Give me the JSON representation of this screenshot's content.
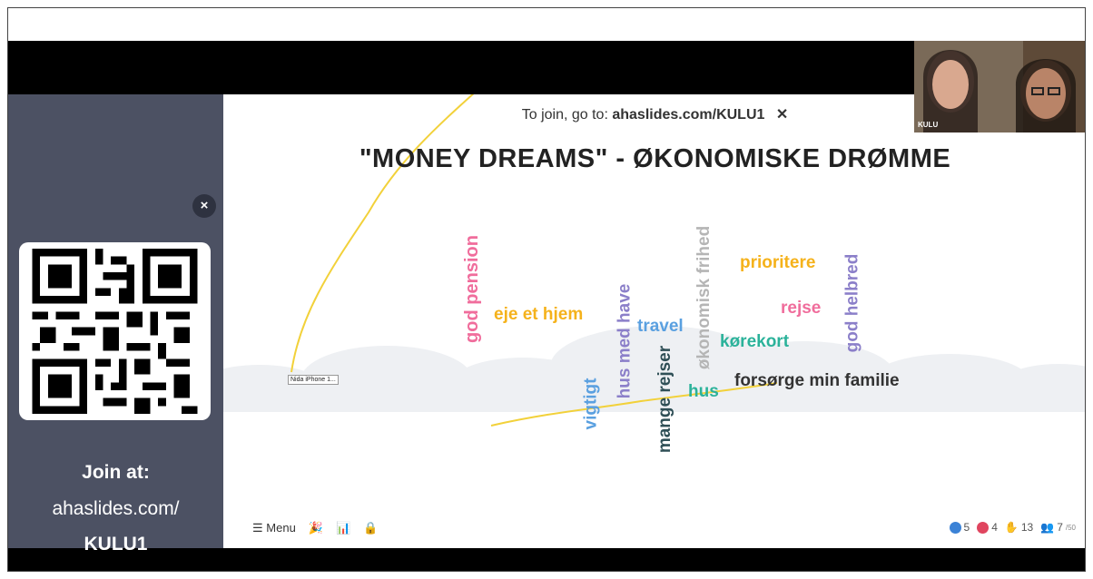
{
  "sidebar": {
    "close_label": "×",
    "join_label": "Join at:",
    "join_url": "ahaslides.com/",
    "join_code": "KULU1"
  },
  "slide": {
    "join_prefix": "To join, go to:",
    "join_url": "ahaslides.com/KULU1",
    "join_close": "✕",
    "title": "\"MONEY DREAMS\" - ØKONOMISKE DRØMME",
    "device_tag": "Nida iPhone 1..."
  },
  "words": [
    {
      "text": "god pension",
      "color": "#f06d9c"
    },
    {
      "text": "eje et hjem",
      "color": "#f5b21b"
    },
    {
      "text": "vigtigt",
      "color": "#5aa0e0"
    },
    {
      "text": "hus med have",
      "color": "#8b7fc9"
    },
    {
      "text": "mange rejser",
      "color": "#2f4f56"
    },
    {
      "text": "travel",
      "color": "#5aa0e0"
    },
    {
      "text": "hus",
      "color": "#2bb29a"
    },
    {
      "text": "økonomisk frihed",
      "color": "#b5b5b5"
    },
    {
      "text": "kørekort",
      "color": "#2bb29a"
    },
    {
      "text": "forsørge min familie",
      "color": "#333333"
    },
    {
      "text": "prioritere",
      "color": "#f5b21b"
    },
    {
      "text": "rejse",
      "color": "#f06d9c"
    },
    {
      "text": "god helbred",
      "color": "#8b7fc9"
    }
  ],
  "toolbar": {
    "menu_label": "Menu",
    "menu_icon": "hamburger-icon",
    "confetti_icon": "confetti-icon",
    "chart_icon": "chart-off-icon",
    "lock_icon": "lock-icon"
  },
  "stats": {
    "likes": "5",
    "hearts": "4",
    "hands": "13",
    "audience": "7",
    "audience_max": "/50"
  },
  "webcam": {
    "label": "KULU"
  },
  "colors": {
    "sidebar": "#4c5163",
    "like": "#3b82d6",
    "heart": "#e0455f"
  }
}
